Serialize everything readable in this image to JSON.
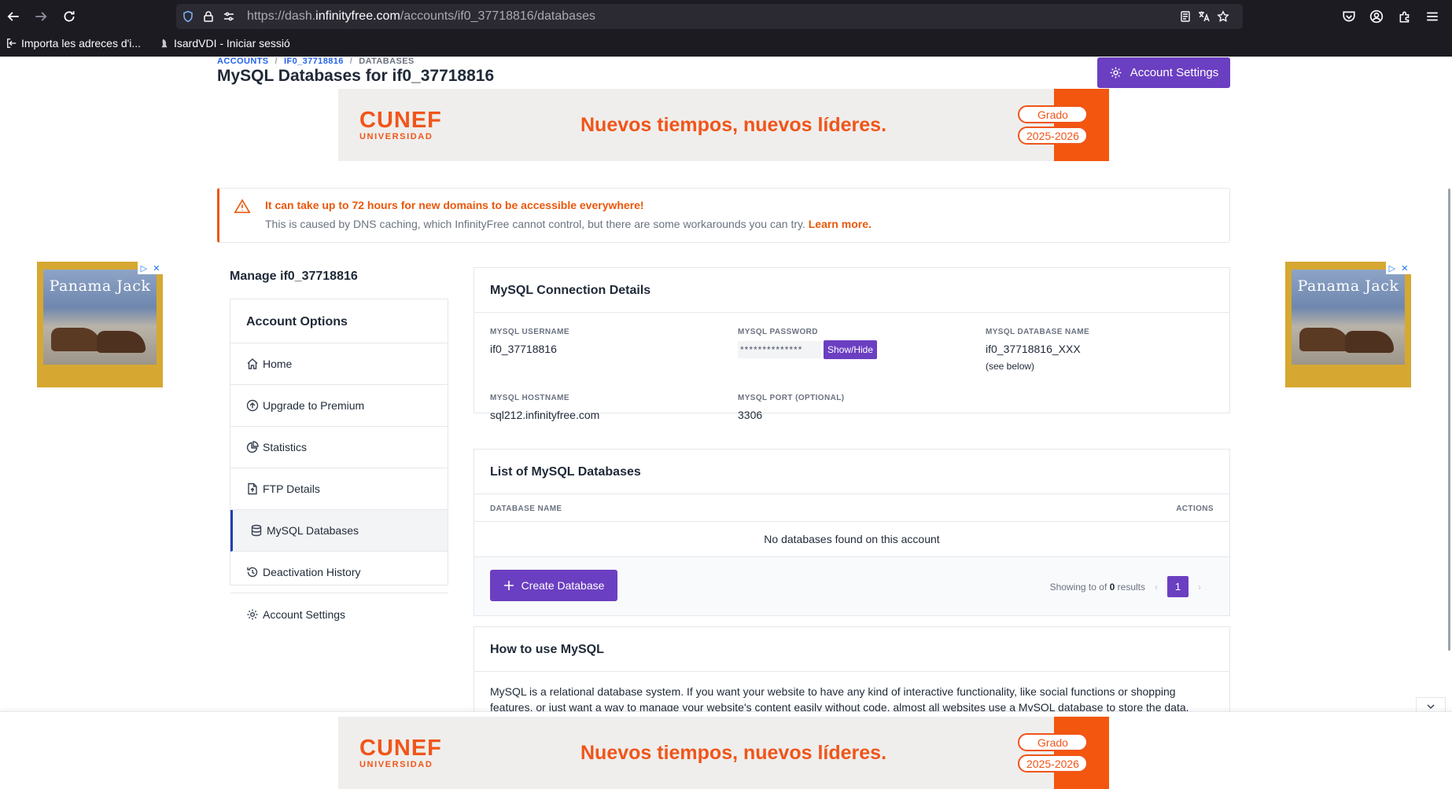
{
  "browser": {
    "url_prefix": "https://dash.",
    "url_domain": "infinityfree.com",
    "url_path": "/accounts/if0_37718816/databases",
    "bookmarks": [
      "Importa les adreces d'i...",
      "IsardVDI - Iniciar sessió"
    ]
  },
  "breadcrumb": {
    "accounts": "ACCOUNTS",
    "account": "IF0_37718816",
    "current": "DATABASES",
    "separator": "/"
  },
  "header": {
    "title": "MySQL Databases for if0_37718816",
    "account_settings_label": "Account Settings"
  },
  "ad_banner": {
    "logo": "CUNEF",
    "logo_sub": "UNIVERSIDAD",
    "slogan": "Nuevos tiempos, nuevos líderes.",
    "pill_1": "Grado",
    "pill_2": "2025-2026"
  },
  "side_ad": {
    "brand": "Panama Jack"
  },
  "alert": {
    "title": "It can take up to 72 hours for new domains to be accessible everywhere!",
    "text": "This is caused by DNS caching, which InfinityFree cannot control, but there are some workarounds you can try.",
    "link": "Learn more."
  },
  "sidebar": {
    "manage_title": "Manage if0_37718816",
    "card_title": "Account Options",
    "items": [
      {
        "label": "Home",
        "icon": "home-icon"
      },
      {
        "label": "Upgrade to Premium",
        "icon": "upgrade-icon"
      },
      {
        "label": "Statistics",
        "icon": "pie-chart-icon"
      },
      {
        "label": "FTP Details",
        "icon": "file-upload-icon"
      },
      {
        "label": "MySQL Databases",
        "icon": "database-icon",
        "active": true
      },
      {
        "label": "Deactivation History",
        "icon": "history-icon"
      },
      {
        "label": "Account Settings",
        "icon": "gear-icon"
      }
    ]
  },
  "connection": {
    "title": "MySQL Connection Details",
    "username_label": "MYSQL USERNAME",
    "username": "if0_37718816",
    "password_label": "MYSQL PASSWORD",
    "password_mask": "**************",
    "show_hide": "Show/Hide",
    "dbname_label": "MYSQL DATABASE NAME",
    "dbname": "if0_37718816_XXX",
    "dbname_note": "(see below)",
    "hostname_label": "MYSQL HOSTNAME",
    "hostname": "sql212.infinityfree.com",
    "port_label": "MYSQL PORT (OPTIONAL)",
    "port": "3306"
  },
  "db_list": {
    "title": "List of MySQL Databases",
    "col_name": "DATABASE NAME",
    "col_actions": "ACTIONS",
    "empty": "No databases found on this account",
    "create_label": "Create Database",
    "showing_prefix": "Showing to of",
    "showing_count": "0",
    "showing_suffix": "results",
    "page": "1"
  },
  "howto": {
    "title": "How to use MySQL",
    "text": "MySQL is a relational database system. If you want your website to have any kind of interactive functionality, like social functions or shopping features, or just want a way to manage your website's content easily without code, almost all websites use a MySQL database to store the data."
  },
  "colors": {
    "brand_purple": "#6b3fc1",
    "warning_orange": "#ea580c",
    "ad_orange": "#f0551a"
  }
}
